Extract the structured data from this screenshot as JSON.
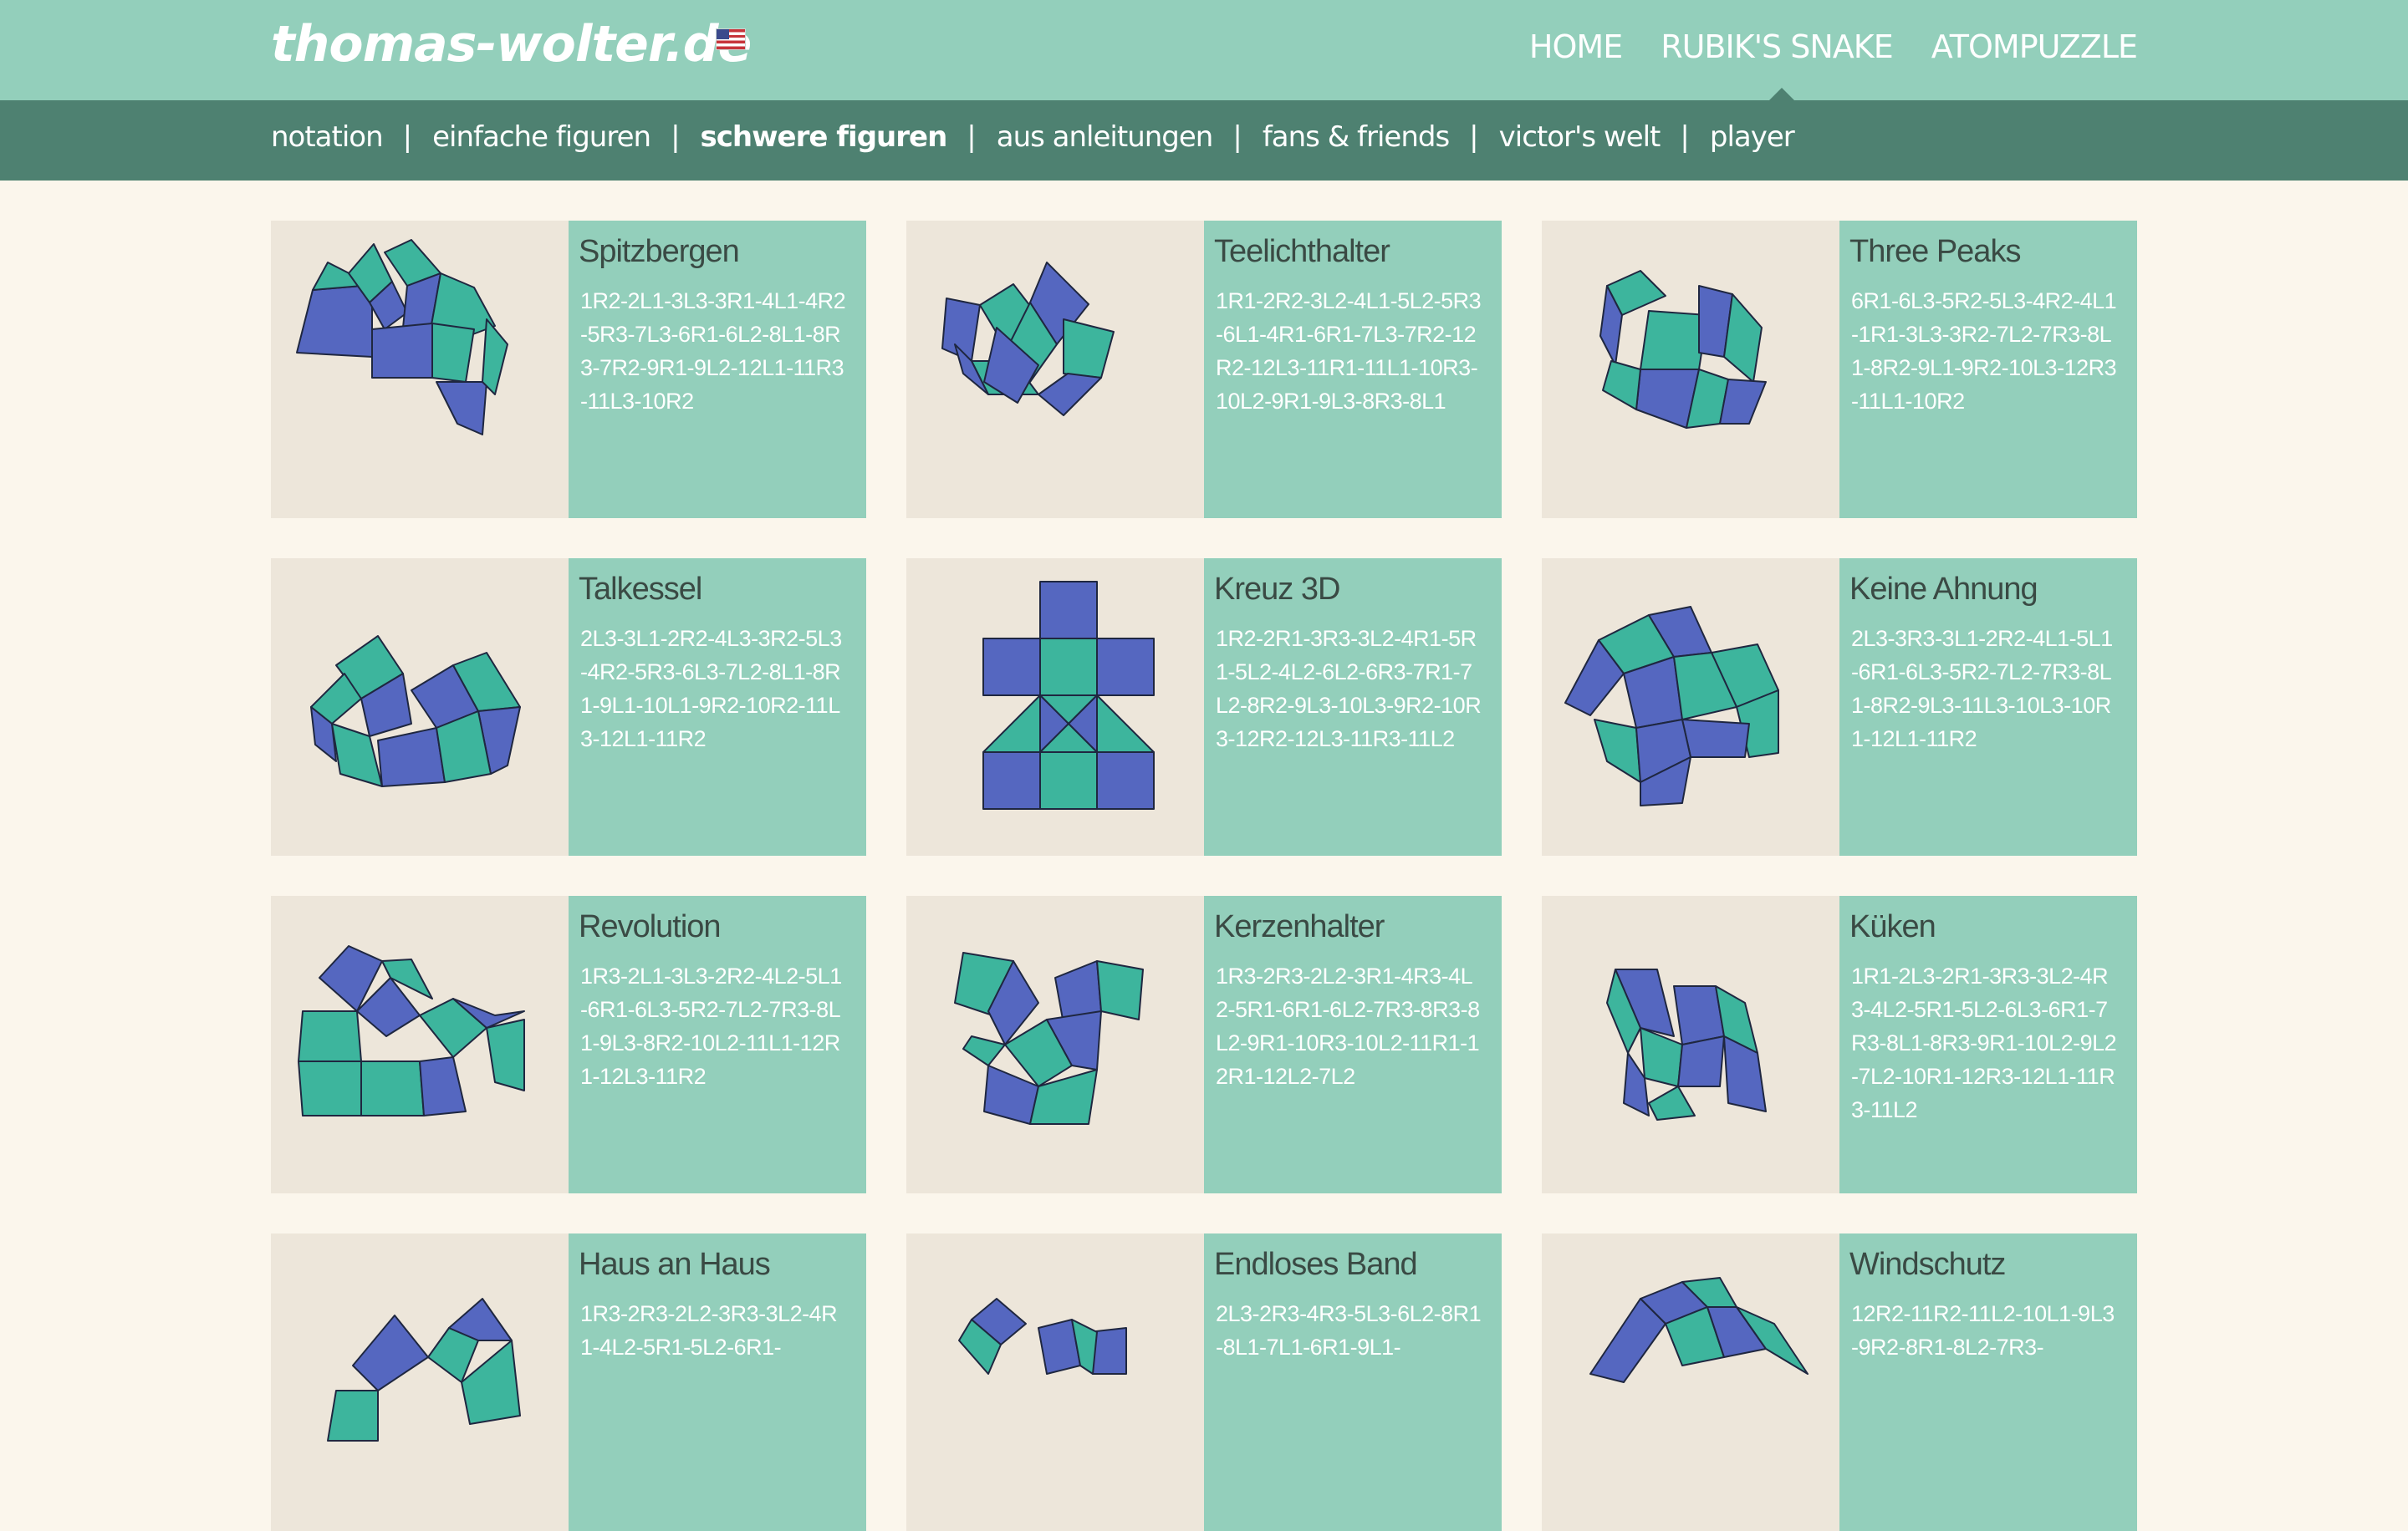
{
  "header": {
    "site_title": "thomas-wolter.de",
    "flag_icon": "us-flag-icon",
    "nav": [
      "HOME",
      "RUBIK'S SNAKE",
      "ATOMPUZZLE"
    ],
    "active_nav": "RUBIK'S SNAKE"
  },
  "subnav": {
    "items": [
      "notation",
      "einfache figuren",
      "schwere figuren",
      "aus anleitungen",
      "fans & friends",
      "victor's welt",
      "player"
    ],
    "active": "schwere figuren",
    "separator": "|"
  },
  "colors": {
    "header_bg": "#93cfbb",
    "subnav_bg": "#4e8171",
    "page_bg": "#fbf6ec",
    "thumb_bg": "#ede6da",
    "card_info_bg": "#93cfbb",
    "piece_blue": "#5567c0",
    "piece_teal": "#3db59d"
  },
  "figures": [
    {
      "name": "Spitzbergen",
      "sequence": "1R2-2L1-3L3-3R1-4L1-4R2-5R3-7L3-6R1-6L2-8L1-8R3-7R2-9R1-9L2-12L1-11R3-11L3-10R2"
    },
    {
      "name": "Teelichthalter",
      "sequence": "1R1-2R2-3L2-4L1-5L2-5R3-6L1-4R1-6R1-7L3-7R2-12R2-12L3-11R1-11L1-10R3-10L2-9R1-9L3-8R3-8L1"
    },
    {
      "name": "Three Peaks",
      "sequence": "6R1-6L3-5R2-5L3-4R2-4L1-1R1-3L3-3R2-7L2-7R3-8L1-8R2-9L1-9R2-10L3-12R3-11L1-10R2"
    },
    {
      "name": "Talkessel",
      "sequence": "2L3-3L1-2R2-4L3-3R2-5L3-4R2-5R3-6L3-7L2-8L1-8R1-9L1-10L1-9R2-10R2-11L3-12L1-11R2"
    },
    {
      "name": "Kreuz 3D",
      "sequence": "1R2-2R1-3R3-3L2-4R1-5R1-5L2-4L2-6L2-6R3-7R1-7L2-8R2-9L3-10L3-9R2-10R3-12R2-12L3-11R3-11L2"
    },
    {
      "name": "Keine Ahnung",
      "sequence": "2L3-3R3-3L1-2R2-4L1-5L1-6R1-6L3-5R2-7L2-7R3-8L1-8R2-9L3-11L3-10L3-10R1-12L1-11R2"
    },
    {
      "name": "Revolution",
      "sequence": "1R3-2L1-3L3-2R2-4L2-5L1-6R1-6L3-5R2-7L2-7R3-8L1-9L3-8R2-10L2-11L1-12R1-12L3-11R2"
    },
    {
      "name": "Kerzenhalter",
      "sequence": "1R3-2R3-2L2-3R1-4R3-4L2-5R1-6R1-6L2-7R3-8R3-8L2-9R1-10R3-10L2-11R1-12R1-12L2-7L2"
    },
    {
      "name": "Küken",
      "sequence": "1R1-2L3-2R1-3R3-3L2-4R3-4L2-5R1-5L2-6L3-6R1-7R3-8L1-8R3-9R1-10L2-9L2-7L2-10R1-12R3-12L1-11R3-11L2"
    },
    {
      "name": "Haus an Haus",
      "sequence": "1R3-2R3-2L2-3R3-3L2-4R1-4L2-5R1-5L2-6R1-"
    },
    {
      "name": "Endloses Band",
      "sequence": "2L3-2R3-4R3-5L3-6L2-8R1-8L1-7L1-6R1-9L1-"
    },
    {
      "name": "Windschutz",
      "sequence": "12R2-11R2-11L2-10L1-9L3-9R2-8R1-8L2-7R3-"
    }
  ]
}
